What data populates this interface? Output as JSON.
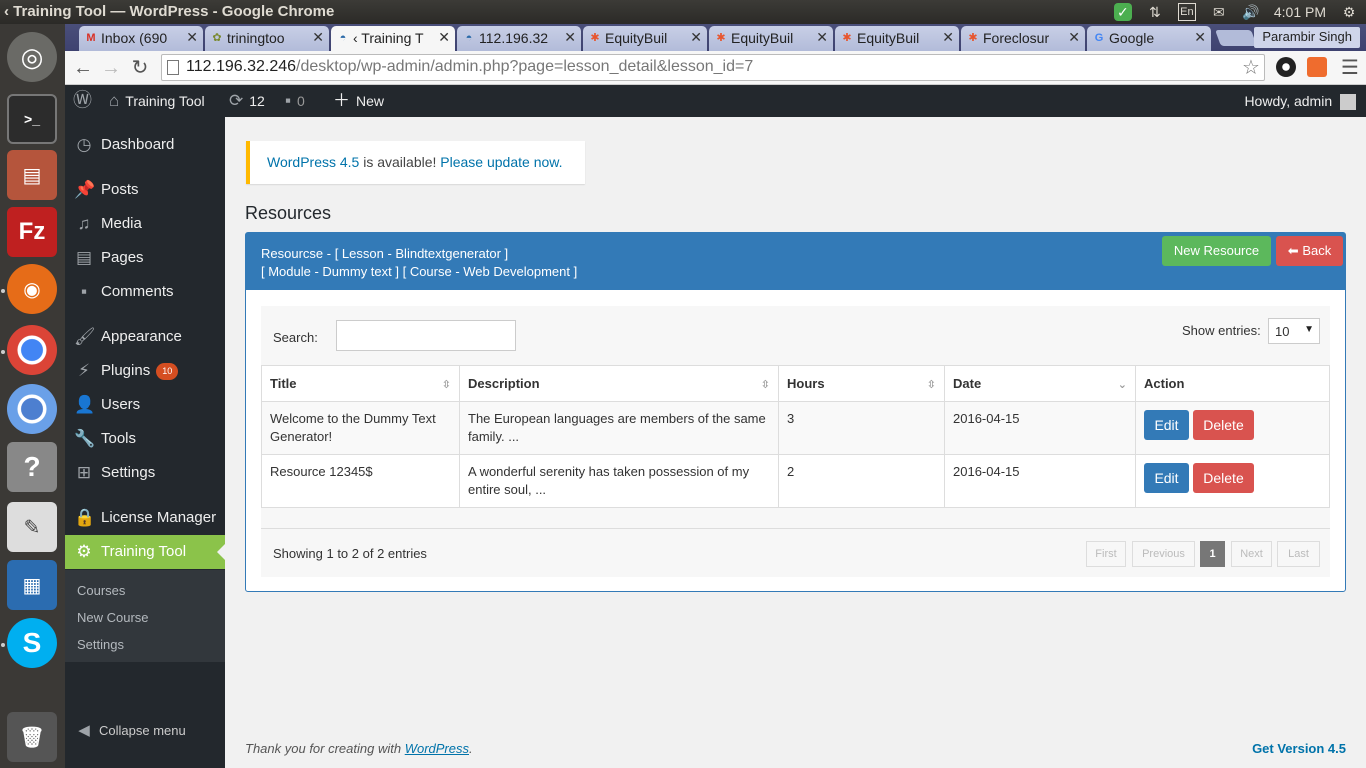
{
  "window": {
    "title": "‹ Training Tool — WordPress - Google Chrome"
  },
  "tray": {
    "time": "4:01 PM",
    "keyboard": "En"
  },
  "browser": {
    "tabs": [
      {
        "label": "Inbox (690",
        "icon": "gmail-icon"
      },
      {
        "label": "triningtoo",
        "icon": "site-icon"
      },
      {
        "label": "‹ Training T",
        "icon": "wordpress-icon"
      },
      {
        "label": "112.196.32",
        "icon": "wordpress-icon"
      },
      {
        "label": "EquityBuil",
        "icon": "joomla-icon"
      },
      {
        "label": "EquityBuil",
        "icon": "joomla-icon"
      },
      {
        "label": "EquityBuil",
        "icon": "joomla-icon"
      },
      {
        "label": "Foreclosur",
        "icon": "joomla-icon"
      },
      {
        "label": "Google",
        "icon": "google-icon"
      }
    ],
    "profile": "Parambir Singh",
    "url_host": "112.196.32.246",
    "url_path": "/desktop/wp-admin/admin.php?page=lesson_detail&lesson_id=7"
  },
  "adminbar": {
    "site": "Training Tool",
    "updates": "12",
    "comments": "0",
    "new": "New",
    "howdy": "Howdy, admin"
  },
  "menu": {
    "items": [
      {
        "label": "Dashboard"
      },
      {
        "label": "Posts"
      },
      {
        "label": "Media"
      },
      {
        "label": "Pages"
      },
      {
        "label": "Comments"
      },
      {
        "label": "Appearance"
      },
      {
        "label": "Plugins",
        "badge": "10"
      },
      {
        "label": "Users"
      },
      {
        "label": "Tools"
      },
      {
        "label": "Settings"
      },
      {
        "label": "License Manager"
      },
      {
        "label": "Training Tool"
      }
    ],
    "submenu": [
      "Courses",
      "New Course",
      "Settings"
    ],
    "collapse": "Collapse menu"
  },
  "notice": {
    "version_link": "WordPress 4.5",
    "text": "is available!",
    "update_link": "Please update now."
  },
  "page_title": "Resources",
  "panel": {
    "line1": "Resourcse - [ Lesson - Blindtextgenerator ]",
    "line2": "[ Module - Dummy text ] [ Course - Web Development ]",
    "new_button": "New Resource",
    "back_button": "Back"
  },
  "datatable": {
    "search_label": "Search:",
    "entries_label": "Show entries:",
    "entries_value": "10",
    "columns": [
      "Title",
      "Description",
      "Hours",
      "Date",
      "Action"
    ],
    "rows": [
      {
        "title": "Welcome to the Dummy Text Generator!",
        "description": "The European languages are members of the same family. ...",
        "hours": "3",
        "date": "2016-04-15"
      },
      {
        "title": "Resource 12345$",
        "description": "A wonderful serenity has taken possession of my entire soul, ...",
        "hours": "2",
        "date": "2016-04-15"
      }
    ],
    "edit_label": "Edit",
    "delete_label": "Delete",
    "showing": "Showing 1 to 2 of 2 entries",
    "pagination": {
      "first": "First",
      "previous": "Previous",
      "current": "1",
      "next": "Next",
      "last": "Last"
    }
  },
  "footer": {
    "thanks_prefix": "Thank you for creating with",
    "thanks_link": "WordPress",
    "version_link": "Get Version 4.5"
  }
}
